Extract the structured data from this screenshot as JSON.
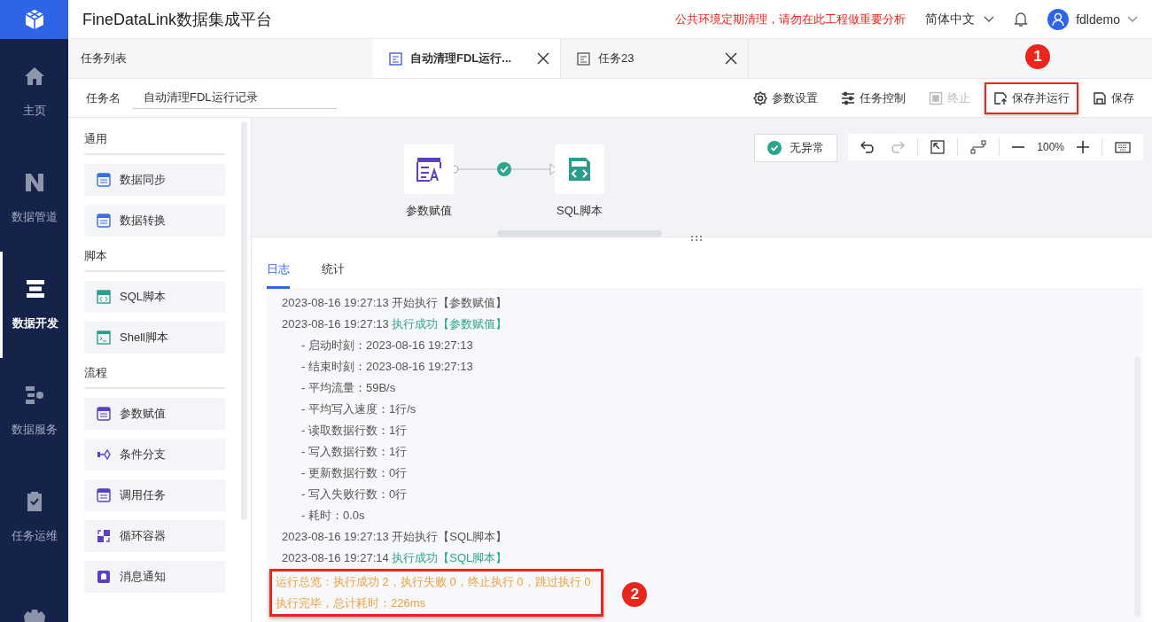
{
  "app": {
    "title": "FineDataLink数据集成平台",
    "notice": "公共环境定期清理，请勿在此工程做重要分析",
    "language": "简体中文",
    "user": "fdldemo"
  },
  "nav": [
    {
      "label": "主页",
      "selected": false
    },
    {
      "label": "数据管道",
      "selected": false
    },
    {
      "label": "数据开发",
      "selected": true
    },
    {
      "label": "数据服务",
      "selected": false
    },
    {
      "label": "任务运维",
      "selected": false
    }
  ],
  "tabs": {
    "list_label": "任务列表",
    "items": [
      {
        "label": "自动清理FDL运行...",
        "selected": true
      },
      {
        "label": "任务23",
        "selected": false
      }
    ]
  },
  "task": {
    "label": "任务名",
    "value": "自动清理FDL运行记录"
  },
  "actions": [
    {
      "label": "参数设置",
      "disabled": false,
      "highlighted": false
    },
    {
      "label": "任务控制",
      "disabled": false,
      "highlighted": false
    },
    {
      "label": "终止",
      "disabled": true,
      "highlighted": false
    },
    {
      "label": "保存并运行",
      "disabled": false,
      "highlighted": true
    },
    {
      "label": "保存",
      "disabled": false,
      "highlighted": false
    }
  ],
  "palette": [
    {
      "title": "通用",
      "items": [
        {
          "label": "数据同步"
        },
        {
          "label": "数据转换"
        }
      ]
    },
    {
      "title": "脚本",
      "items": [
        {
          "label": "SQL脚本"
        },
        {
          "label": "Shell脚本"
        }
      ]
    },
    {
      "title": "流程",
      "items": [
        {
          "label": "参数赋值"
        },
        {
          "label": "条件分支"
        },
        {
          "label": "调用任务"
        },
        {
          "label": "循环容器"
        },
        {
          "label": "消息通知"
        }
      ]
    }
  ],
  "canvas": {
    "nodes": [
      {
        "label": "参数赋值"
      },
      {
        "label": "SQL脚本"
      }
    ],
    "status": "无异常",
    "zoom": "100%"
  },
  "log_tabs": [
    {
      "label": "日志",
      "selected": true
    },
    {
      "label": "统计",
      "selected": false
    }
  ],
  "log": [
    {
      "kind": "event",
      "time": "2023-08-16 19:27:13",
      "action": "开始执行",
      "target": "【参数赋值】",
      "success": false
    },
    {
      "kind": "event",
      "time": "2023-08-16 19:27:13",
      "action": "执行成功",
      "target": "【参数赋值】",
      "success": true
    },
    {
      "kind": "detail",
      "text": "- 启动时刻：2023-08-16 19:27:13"
    },
    {
      "kind": "detail",
      "text": "- 结束时刻：2023-08-16 19:27:13"
    },
    {
      "kind": "detail",
      "text": "- 平均流量：59B/s"
    },
    {
      "kind": "detail",
      "text": "- 平均写入速度：1行/s"
    },
    {
      "kind": "detail",
      "text": "- 读取数据行数：1行"
    },
    {
      "kind": "detail",
      "text": "- 写入数据行数：1行"
    },
    {
      "kind": "detail",
      "text": "- 更新数据行数：0行"
    },
    {
      "kind": "detail",
      "text": "- 写入失败行数：0行"
    },
    {
      "kind": "detail",
      "text": "- 耗时：0.0s"
    },
    {
      "kind": "event",
      "time": "2023-08-16 19:27:13",
      "action": "开始执行",
      "target": "【SQL脚本】",
      "success": false
    },
    {
      "kind": "event",
      "time": "2023-08-16 19:27:14",
      "action": "执行成功",
      "target": "【SQL脚本】",
      "success": true
    }
  ],
  "summary": {
    "lines": [
      "运行总览：执行成功 2，执行失败 0，终止执行 0，跳过执行 0",
      "执行完毕，总计耗时：226ms"
    ],
    "marker": "2"
  },
  "action_marker": "1"
}
